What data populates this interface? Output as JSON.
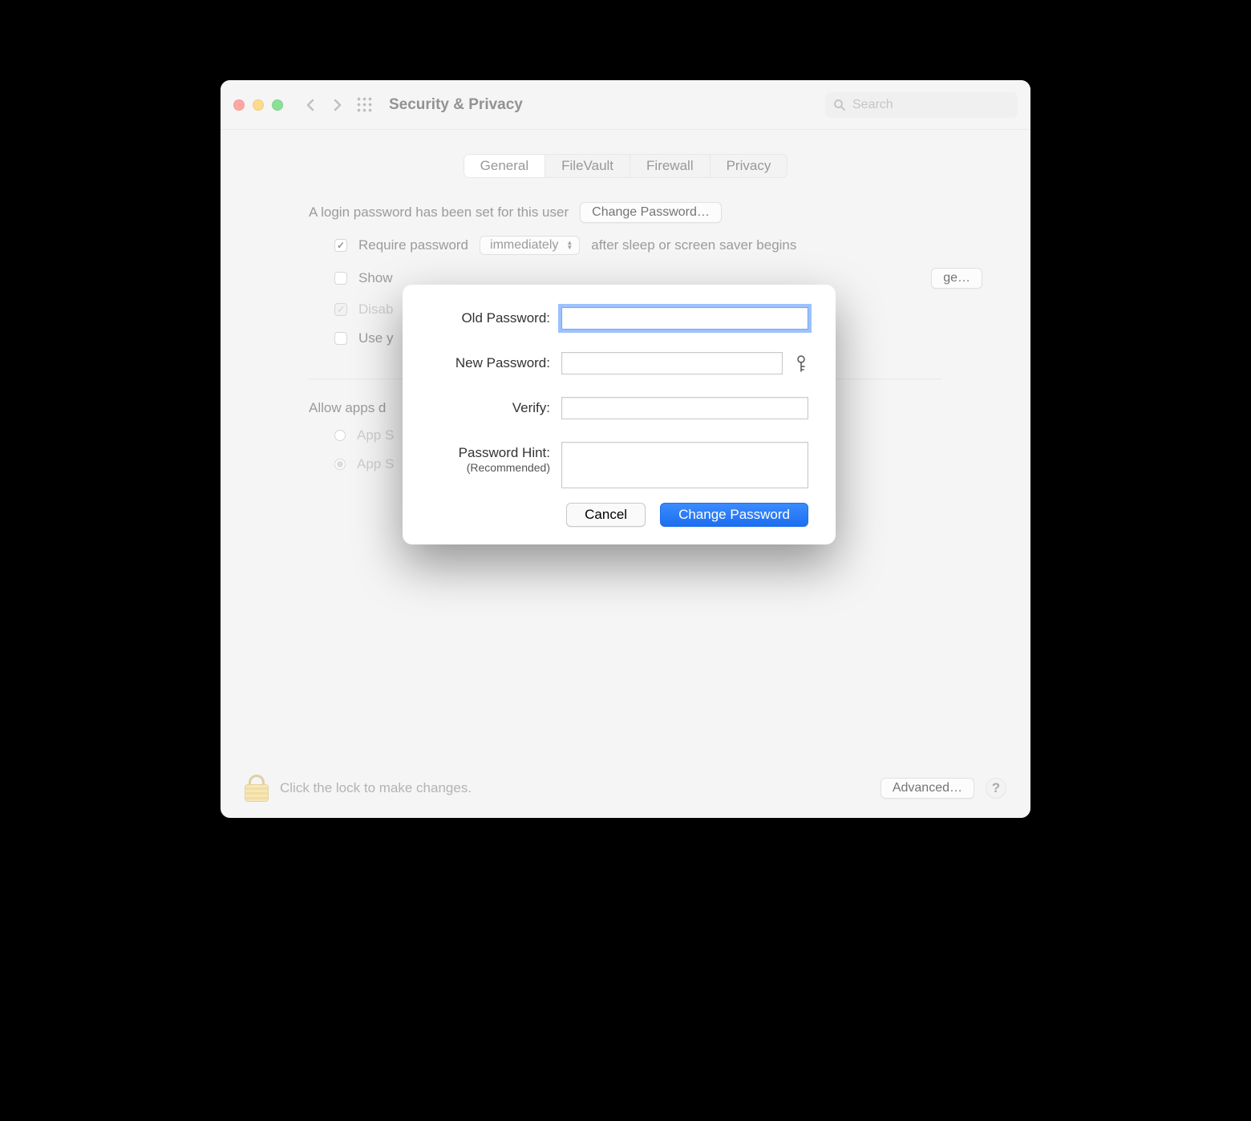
{
  "window": {
    "title": "Security & Privacy",
    "search_placeholder": "Search",
    "tabs": [
      {
        "label": "General",
        "active": true
      },
      {
        "label": "FileVault",
        "active": false
      },
      {
        "label": "Firewall",
        "active": false
      },
      {
        "label": "Privacy",
        "active": false
      }
    ],
    "login_text": "A login password has been set for this user",
    "change_password_btn": "Change Password…",
    "require_password_label": "Require password",
    "require_password_dropdown": "immediately",
    "require_password_suffix": "after sleep or screen saver begins",
    "show_message_label_partial": "Show",
    "set_lock_message_btn_partial": "ge…",
    "disable_autologin_label_partial": "Disab",
    "use_applewatch_label_partial": "Use y",
    "allow_apps_label_partial": "Allow apps d",
    "app_store_label_partial": "App S",
    "app_store_identified_label_partial": "App S",
    "footer_text": "Click the lock to make changes.",
    "advanced_btn": "Advanced…",
    "help_glyph": "?"
  },
  "sheet": {
    "old_password_label": "Old Password:",
    "new_password_label": "New Password:",
    "verify_label": "Verify:",
    "hint_label": "Password Hint:",
    "hint_sublabel": "(Recommended)",
    "cancel_btn": "Cancel",
    "submit_btn": "Change Password"
  }
}
